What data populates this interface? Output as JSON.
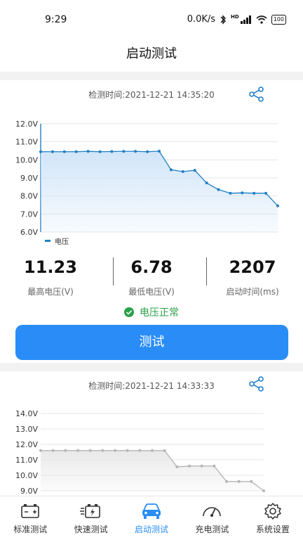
{
  "status_bar": {
    "time": "9:29",
    "network_speed": "0.0K/s",
    "signal_label": "HD",
    "battery": "100"
  },
  "nav": {
    "title": "启动测试"
  },
  "test1": {
    "timestamp": "检测时间:2021-12-21 14:35:20",
    "legend": "电压",
    "stats": [
      {
        "value": "11.23",
        "label": "最高电压(V)"
      },
      {
        "value": "6.78",
        "label": "最低电压(V)"
      },
      {
        "value": "2207",
        "label": "启动时间(ms)"
      }
    ],
    "status": "电压正常",
    "button": "测试"
  },
  "test2": {
    "timestamp": "检测时间:2021-12-21 14:33:33"
  },
  "bottom_nav": [
    {
      "label": "标准测试",
      "icon": "battery-icon"
    },
    {
      "label": "快速测试",
      "icon": "quick-charge-icon"
    },
    {
      "label": "启动测试",
      "icon": "car-icon"
    },
    {
      "label": "充电测试",
      "icon": "gauge-icon"
    },
    {
      "label": "系统设置",
      "icon": "gear-icon"
    }
  ],
  "colors": {
    "accent": "#2a8df7",
    "ok": "#2aa148",
    "line1": "#1f7fc4",
    "fill1": "#cfe4f8",
    "line2": "#b5b5b5",
    "fill2": "#e8e8e8"
  },
  "chart_data": [
    {
      "type": "area",
      "y_ticks": [
        "12.0V",
        "11.0V",
        "10.0V",
        "9.0V",
        "8.0V",
        "7.0V",
        "6.0V"
      ],
      "ylim": [
        6.0,
        12.0
      ],
      "series": [
        {
          "name": "电压",
          "values": [
            10.45,
            10.45,
            10.45,
            10.45,
            10.47,
            10.45,
            10.46,
            10.47,
            10.47,
            10.45,
            10.48,
            9.45,
            9.35,
            9.42,
            8.72,
            8.35,
            8.15,
            8.17,
            8.15,
            8.15,
            7.45
          ]
        }
      ]
    },
    {
      "type": "area",
      "y_ticks": [
        "14.0V",
        "13.0V",
        "12.0V",
        "11.0V",
        "10.0V",
        "9.0V"
      ],
      "ylim": [
        9.0,
        14.0
      ],
      "series": [
        {
          "values": [
            11.6,
            11.6,
            11.6,
            11.6,
            11.6,
            11.6,
            11.6,
            11.6,
            11.6,
            11.6,
            11.6,
            10.55,
            10.6,
            10.6,
            10.6,
            9.6,
            9.6,
            9.6,
            9.0
          ]
        }
      ]
    }
  ]
}
